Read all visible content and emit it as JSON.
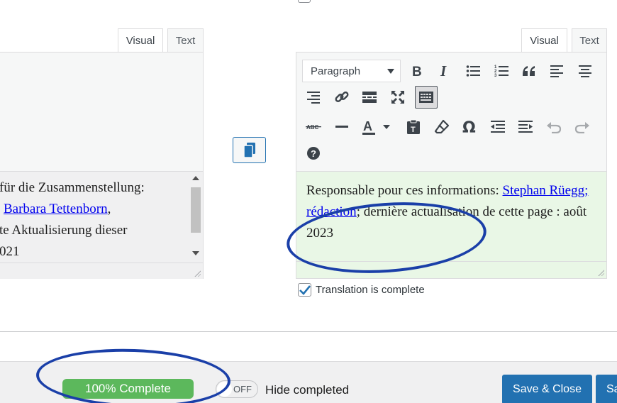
{
  "left_editor": {
    "tabs": {
      "visual": "Visual",
      "text": "Text"
    },
    "content": {
      "line1": "für die Zusammenstellung:",
      "link_name": "Barbara Tettenborn",
      "line2_after": ",",
      "line3": "te Aktualisierung dieser",
      "line4": "021"
    }
  },
  "right_editor": {
    "tabs": {
      "visual": "Visual",
      "text": "Text"
    },
    "format_select": "Paragraph",
    "toolbar_icons": [
      "bold-icon",
      "italic-icon",
      "bullet-list-icon",
      "numbered-list-icon",
      "blockquote-icon",
      "align-left-icon",
      "align-center-icon",
      "align-right-icon",
      "link-icon",
      "read-more-icon",
      "fullscreen-icon",
      "toolbar-toggle-icon",
      "strikethrough-icon",
      "horizontal-rule-icon",
      "text-color-icon",
      "paste-text-icon",
      "clear-formatting-icon",
      "special-character-icon",
      "outdent-icon",
      "indent-icon",
      "undo-icon",
      "redo-icon",
      "help-icon"
    ],
    "content": {
      "prefix": "Responsable pour ces informations: ",
      "link": "Stephan Rüegg; rédaction",
      "mid": "; dernière actualisation de cette page : août 2023"
    }
  },
  "translation_complete": {
    "label": "Translation is complete",
    "checked": true
  },
  "bottom_bar": {
    "progress_label": "100% Complete",
    "progress_fraction": 1.0,
    "toggle_label": "OFF",
    "hide_completed_label": "Hide completed",
    "save_close_label": "Save & Close",
    "save_label": "Sa"
  },
  "colors": {
    "accent": "#2271b1",
    "progress": "#5cb85c",
    "annotation": "#1a3fa8",
    "translated_bg": "#e9f7e6"
  }
}
